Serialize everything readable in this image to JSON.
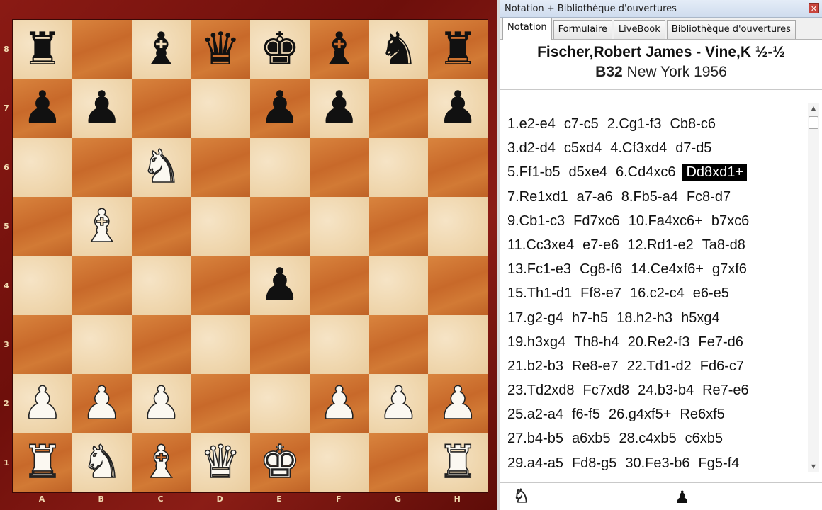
{
  "board": {
    "files": [
      "A",
      "B",
      "C",
      "D",
      "E",
      "F",
      "G",
      "H"
    ],
    "ranks": [
      "8",
      "7",
      "6",
      "5",
      "4",
      "3",
      "2",
      "1"
    ],
    "pieces": [
      [
        "r",
        "",
        "b",
        "q",
        "k",
        "b",
        "n",
        "r"
      ],
      [
        "p",
        "p",
        "",
        "",
        "p",
        "p",
        "",
        "p"
      ],
      [
        "",
        "",
        "N",
        "",
        "",
        "",
        "",
        ""
      ],
      [
        "",
        "B",
        "",
        "",
        "",
        "",
        "",
        ""
      ],
      [
        "",
        "",
        "",
        "",
        "p",
        "",
        "",
        ""
      ],
      [
        "",
        "",
        "",
        "",
        "",
        "",
        "",
        ""
      ],
      [
        "P",
        "P",
        "P",
        "",
        "",
        "P",
        "P",
        "P"
      ],
      [
        "R",
        "N",
        "B",
        "Q",
        "K",
        "",
        "",
        "R"
      ]
    ]
  },
  "panel": {
    "title": "Notation + Bibliothèque d'ouvertures",
    "close_glyph": "✕",
    "tabs": [
      {
        "label": "Notation",
        "active": true
      },
      {
        "label": "Formulaire",
        "active": false
      },
      {
        "label": "LiveBook",
        "active": false
      },
      {
        "label": "Bibliothèque d'ouvertures",
        "active": false
      }
    ],
    "game": {
      "title": "Fischer,Robert James - Vine,K  ½-½",
      "eco": "B32",
      "event": "New York 1956"
    },
    "moves": [
      [
        "1.e2-e4",
        "c7-c5",
        "2.Cg1-f3",
        "Cb8-c6"
      ],
      [
        "3.d2-d4",
        "c5xd4",
        "4.Cf3xd4",
        "d7-d5"
      ],
      [
        "5.Ff1-b5",
        "d5xe4",
        "6.Cd4xc6",
        "Dd8xd1+"
      ],
      [
        "7.Re1xd1",
        "a7-a6",
        "8.Fb5-a4",
        "Fc8-d7"
      ],
      [
        "9.Cb1-c3",
        "Fd7xc6",
        "10.Fa4xc6+",
        "b7xc6"
      ],
      [
        "11.Cc3xe4",
        "e7-e6",
        "12.Rd1-e2",
        "Ta8-d8"
      ],
      [
        "13.Fc1-e3",
        "Cg8-f6",
        "14.Ce4xf6+",
        "g7xf6"
      ],
      [
        "15.Th1-d1",
        "Ff8-e7",
        "16.c2-c4",
        "e6-e5"
      ],
      [
        "17.g2-g4",
        "h7-h5",
        "18.h2-h3",
        "h5xg4"
      ],
      [
        "19.h3xg4",
        "Th8-h4",
        "20.Re2-f3",
        "Fe7-d6"
      ],
      [
        "21.b2-b3",
        "Re8-e7",
        "22.Td1-d2",
        "Fd6-c7"
      ],
      [
        "23.Td2xd8",
        "Fc7xd8",
        "24.b3-b4",
        "Re7-e6"
      ],
      [
        "25.a2-a4",
        "f6-f5",
        "26.g4xf5+",
        "Re6xf5"
      ],
      [
        "27.b4-b5",
        "a6xb5",
        "28.c4xb5",
        "c6xb5"
      ],
      [
        "29.a4-a5",
        "Fd8-g5",
        "30.Fe3-b6",
        "Fg5-f4"
      ]
    ],
    "highlighted_move": "Dd8xd1+",
    "footer": {
      "knight_glyph": "♘",
      "pawn_glyph": "♟"
    }
  },
  "colors": {
    "light_square": "#efd6ad",
    "dark_square": "#c8692a",
    "frame": "#7a1410",
    "highlight": "#000000"
  }
}
